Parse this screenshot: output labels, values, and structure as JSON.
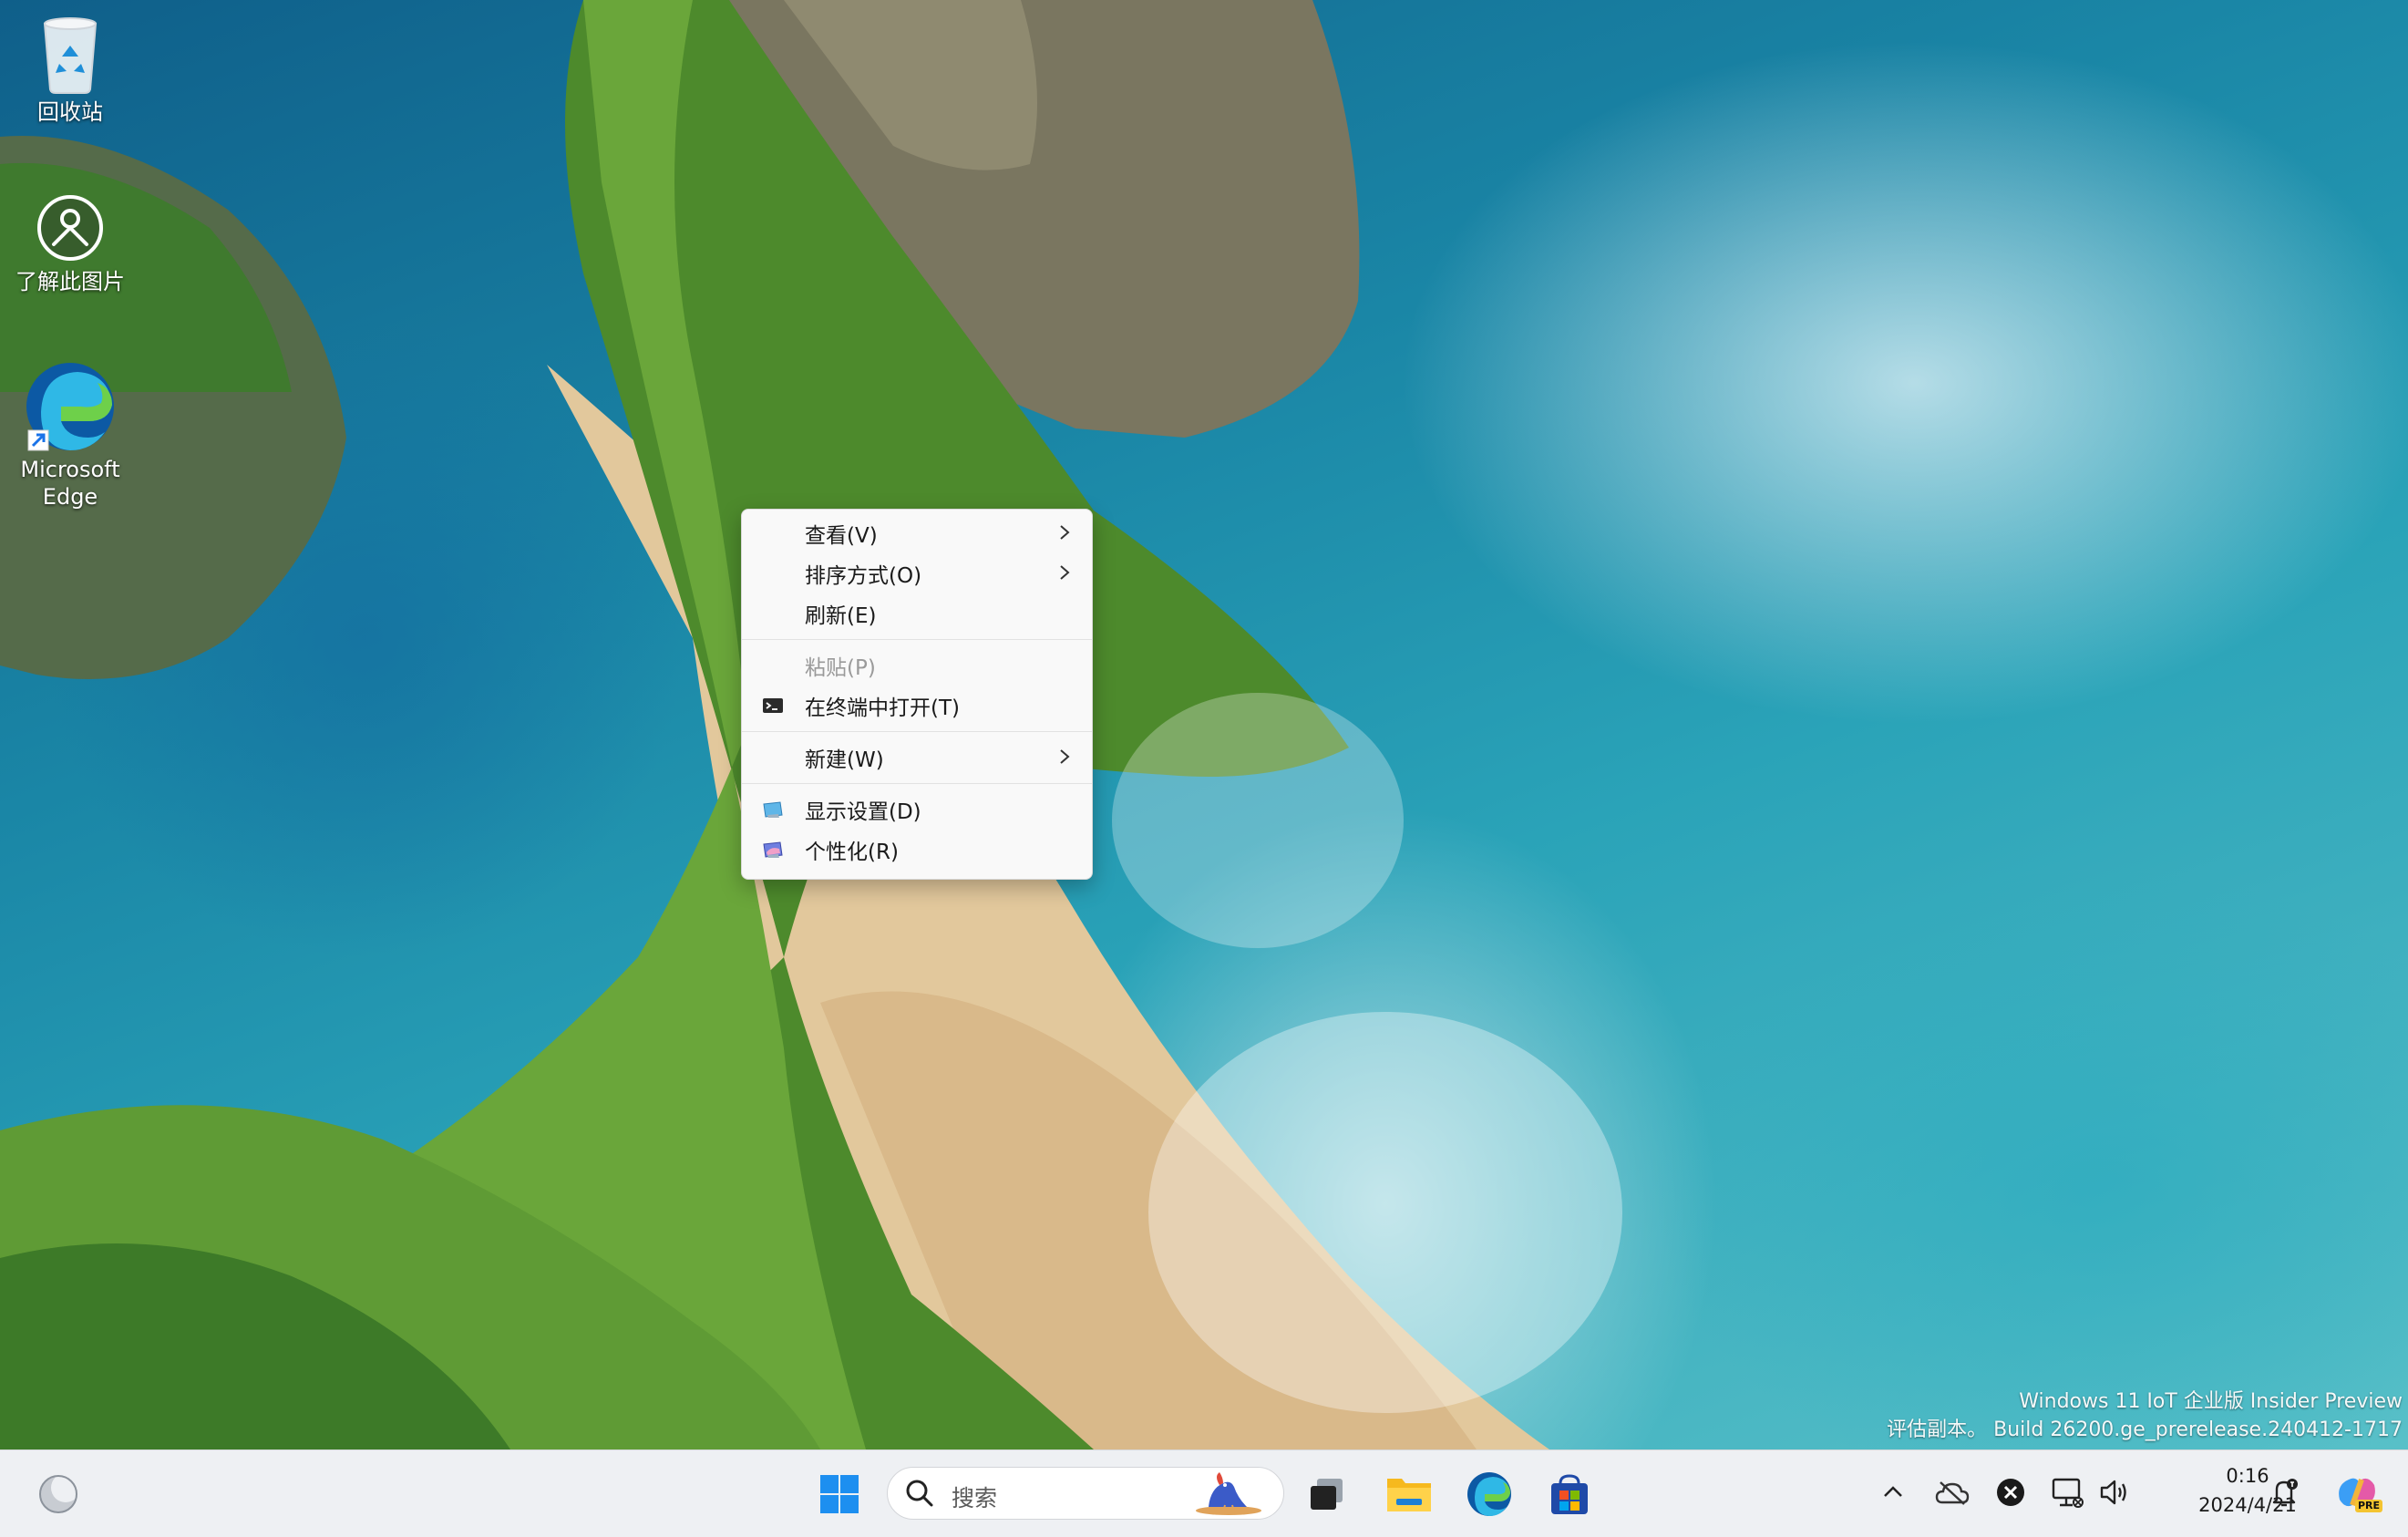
{
  "desktop_icons": [
    {
      "name": "recycle-bin",
      "label": "回收站"
    },
    {
      "name": "learn-about-picture",
      "label": "了解此图片"
    },
    {
      "name": "microsoft-edge",
      "label": "Microsoft Edge"
    }
  ],
  "context_menu": {
    "items": [
      {
        "label": "查看(V)",
        "submenu": true
      },
      {
        "label": "排序方式(O)",
        "submenu": true
      },
      {
        "label": "刷新(E)"
      },
      {
        "label": "粘贴(P)",
        "disabled": true
      },
      {
        "label": "在终端中打开(T)",
        "icon": "terminal-icon"
      },
      {
        "label": "新建(W)",
        "submenu": true
      },
      {
        "label": "显示设置(D)",
        "icon": "display-settings-icon"
      },
      {
        "label": "个性化(R)",
        "icon": "personalize-icon"
      }
    ]
  },
  "watermark": {
    "line1": "Windows 11 IoT 企业版 Insider Preview",
    "line2": "评估副本。 Build 26200.ge_prerelease.240412-1717"
  },
  "taskbar": {
    "search_placeholder": "搜索",
    "time": "0:16",
    "date": "2024/4/21",
    "copilot_badge": "PRE"
  },
  "colors": {
    "accent": "#0067c0",
    "taskbar_bg": "#eef0f3",
    "menu_bg": "#f9f9f9"
  }
}
